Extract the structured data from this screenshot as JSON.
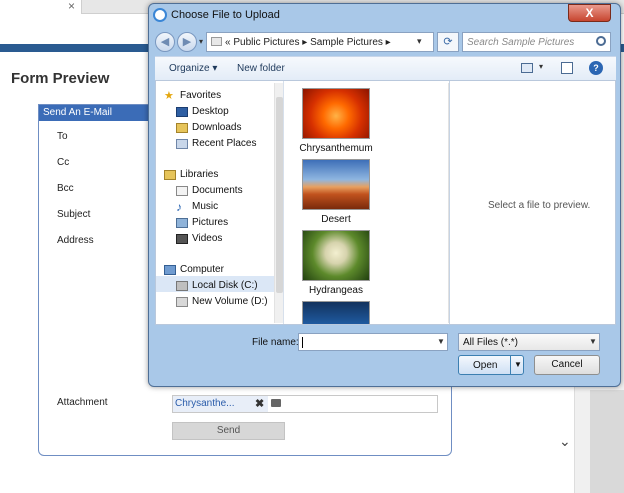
{
  "background": {
    "tab_close": "×",
    "form_title": "Form Preview",
    "form_header": "Send An E-Mail",
    "labels": [
      "To",
      "Cc",
      "Bcc",
      "Subject",
      "Address",
      "Attachment"
    ],
    "attachment_file": "Chrysanthe...",
    "attachment_remove": "✖",
    "send_label": "Send",
    "chevron": "⌄"
  },
  "dialog": {
    "title": "Choose File to Upload",
    "close_glyph": "X",
    "address": {
      "prefix": "«",
      "path": [
        "Public Pictures",
        "Sample Pictures"
      ],
      "separator": "▸"
    },
    "search_placeholder": "Search Sample Pictures",
    "toolbar": {
      "organize": "Organize ▾",
      "new_folder": "New folder",
      "help": "?"
    },
    "nav": {
      "favorites": "Favorites",
      "favorites_items": [
        "Desktop",
        "Downloads",
        "Recent Places"
      ],
      "libraries": "Libraries",
      "libraries_items": [
        "Documents",
        "Music",
        "Pictures",
        "Videos"
      ],
      "computer": "Computer",
      "computer_items": [
        "Local Disk (C:)",
        "New Volume (D:)"
      ],
      "selected": "Local Disk (C:)"
    },
    "files": [
      "Chrysanthemum",
      "Desert",
      "Hydrangeas"
    ],
    "preview_text": "Select a file to preview.",
    "file_name_label": "File name:",
    "file_name_value": "",
    "filter_value": "All Files (*.*)",
    "open_label": "Open",
    "cancel_label": "Cancel"
  }
}
